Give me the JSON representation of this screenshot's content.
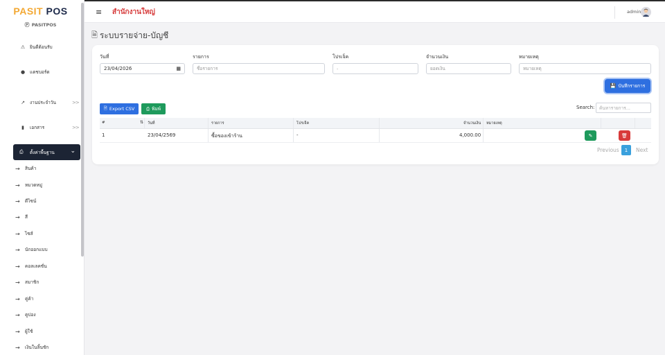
{
  "app": {
    "brand_part1": "PASIT",
    "brand_part2": "POS",
    "sub_brand": "PASITPOS"
  },
  "sidebar": {
    "items": [
      {
        "label": "ยินดีต้อนรับ",
        "icon": "warning-icon"
      },
      {
        "label": "แดชบอร์ด",
        "icon": "info-circle-icon"
      },
      {
        "label": "งานประจำวัน",
        "icon": "trend-icon",
        "chevron": ">>"
      },
      {
        "label": "เอกสาร",
        "icon": "document-icon",
        "chevron": ">>"
      }
    ],
    "active_item": {
      "label": "ตั้งค่าพื้นฐาน",
      "icon": "printer-icon"
    },
    "sub_items": [
      "สินค้า",
      "หมวดหมู่",
      "ดีไซน์",
      "สี",
      "ไซส์",
      "นักออกแบบ",
      "คอลเลคชั่น",
      "สมาชิก",
      "คู่ค้า",
      "คูปอง",
      "ผู้ใช้",
      "เงินในลิ้นชัก"
    ]
  },
  "topbar": {
    "branch": "สำนักงานใหญ่",
    "user": "admin"
  },
  "page": {
    "title": "ระบบรายจ่าย-บัญชี"
  },
  "form": {
    "date_label": "วันที่",
    "date_value": "23/04/2026",
    "item_label": "รายการ",
    "item_placeholder": "ชื่อรายการ",
    "project_label": "โปรเจ็ค",
    "project_value": "-",
    "amount_label": "จำนวนเงิน",
    "amount_placeholder": "ยอดเงิน",
    "note_label": "หมายเหตุ",
    "note_placeholder": "หมายเหตุ",
    "save_label": "บันทึกรายการ"
  },
  "toolbar": {
    "csv_label": "Export CSV",
    "print_label": "พิมพ์",
    "search_label": "Search:",
    "search_placeholder": "ค้นหารายการ..."
  },
  "table": {
    "headers": [
      "#",
      "วันที่",
      "รายการ",
      "โปรเจ็ค",
      "จำนวนเงิน",
      "หมายเหตุ"
    ],
    "rows": [
      {
        "no": "1",
        "date": "23/04/2569",
        "item": "ซื้อของเข้าร้าน",
        "project": "-",
        "amount": "4,000.00",
        "note": ""
      }
    ]
  },
  "pagination": {
    "prev": "Previous",
    "page": "1",
    "next": "Next"
  },
  "colors": {
    "brand_orange": "#f3a833",
    "brand_navy": "#1d2a4a",
    "primary": "#2e6fe0",
    "success": "#1e9a5c",
    "danger": "#d83a3a",
    "branch_red": "#d63a3a"
  }
}
